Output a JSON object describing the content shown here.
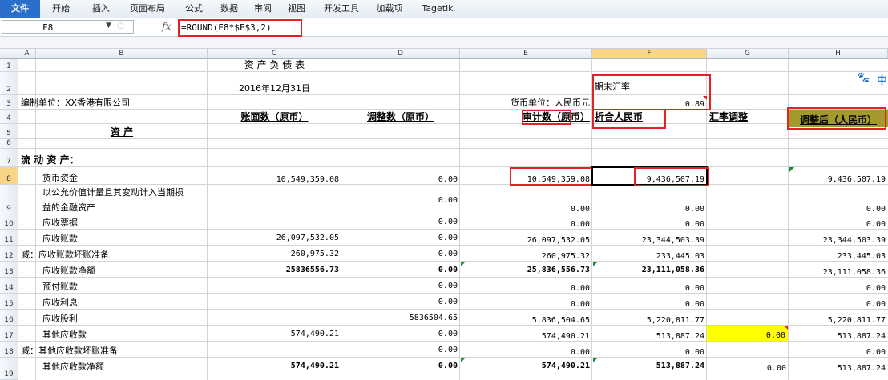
{
  "ribbon": {
    "tabs": [
      "文件",
      "开始",
      "插入",
      "页面布局",
      "公式",
      "数据",
      "审阅",
      "视图",
      "开发工具",
      "加载项",
      "Tagetik"
    ]
  },
  "formula_bar": {
    "name_box": "F8",
    "fx_symbol": "fx",
    "formula": "=ROUND(E8*$F$3,2)"
  },
  "columns": [
    "A",
    "B",
    "C",
    "D",
    "E",
    "F",
    "G",
    "H"
  ],
  "selected_column": "F",
  "selected_row": "8",
  "rows": [
    "1",
    "2",
    "3",
    "4",
    "5",
    "6",
    "7",
    "8",
    "9",
    "10",
    "11",
    "12",
    "13",
    "14",
    "15",
    "16",
    "17",
    "18",
    "19"
  ],
  "sheet": {
    "title": "资 产 负 债 表",
    "date": "2016年12月31日",
    "period_rate_label": "期末汇率",
    "company": "编制单位：XX香港有限公司",
    "currency_unit": "货币单位：人民币元",
    "rate_value": "0.89",
    "headers": {
      "book": "账面数（原币）",
      "adjust": "调整数（原币）",
      "audit": "审计数（原币）",
      "rmb": "折合人民币",
      "fx_adjust": "汇率调整",
      "adjusted": "调整后（人民币）"
    },
    "assets": "资 产",
    "current_assets": "流 动 资 产：",
    "r8": {
      "label": "货币资金",
      "c": "10,549,359.08",
      "d": "0.00",
      "e": "10,549,359.08",
      "f": "9,436,507.19",
      "h": "9,436,507.19"
    },
    "r9": {
      "label1": "以公允价值计量且其变动计入当期损",
      "label2": "益的金融资产",
      "d": "0.00",
      "e": "0.00",
      "f": "0.00",
      "h": "0.00"
    },
    "r10": {
      "label": "应收票据",
      "d": "0.00",
      "e": "0.00",
      "f": "0.00",
      "h": "0.00"
    },
    "r11": {
      "label": "应收账款",
      "c": "26,097,532.05",
      "d": "0.00",
      "e": "26,097,532.05",
      "f": "23,344,503.39",
      "h": "23,344,503.39"
    },
    "r12": {
      "label": "减：应收账款坏账准备",
      "c": "260,975.32",
      "d": "0.00",
      "e": "260,975.32",
      "f": "233,445.03",
      "h": "233,445.03"
    },
    "r13": {
      "label": "应收账款净额",
      "c": "25836556.73",
      "d": "0.00",
      "e": "25,836,556.73",
      "f": "23,111,058.36",
      "h": "23,111,058.36"
    },
    "r14": {
      "label": "预付账款",
      "d": "0.00",
      "e": "0.00",
      "f": "0.00",
      "h": "0.00"
    },
    "r15": {
      "label": "应收利息",
      "d": "0.00",
      "e": "0.00",
      "f": "0.00",
      "h": "0.00"
    },
    "r16": {
      "label": "应收股利",
      "d": "5836504.65",
      "e": "5,836,504.65",
      "f": "5,220,811.77",
      "h": "5,220,811.77"
    },
    "r17": {
      "label": "其他应收款",
      "c": "574,490.21",
      "d": "0.00",
      "e": "574,490.21",
      "f": "513,887.24",
      "g": "0.00",
      "h": "513,887.24"
    },
    "r18": {
      "label": "减：其他应收款坏账准备",
      "d": "0.00",
      "e": "0.00",
      "f": "0.00",
      "h": "0.00"
    },
    "r19": {
      "label": "其他应收款净额",
      "c": "574,490.21",
      "d": "0.00",
      "e": "574,490.21",
      "f": "513,887.24",
      "g": "0.00",
      "h": "513,887.24"
    }
  },
  "overlay": {
    "zh_char": "中"
  },
  "colors": {
    "file_tab": "#2a6fc9",
    "highlight_box": "#e32228",
    "yellow_fill": "#ffff00",
    "header_fill": "#a39a2d"
  }
}
